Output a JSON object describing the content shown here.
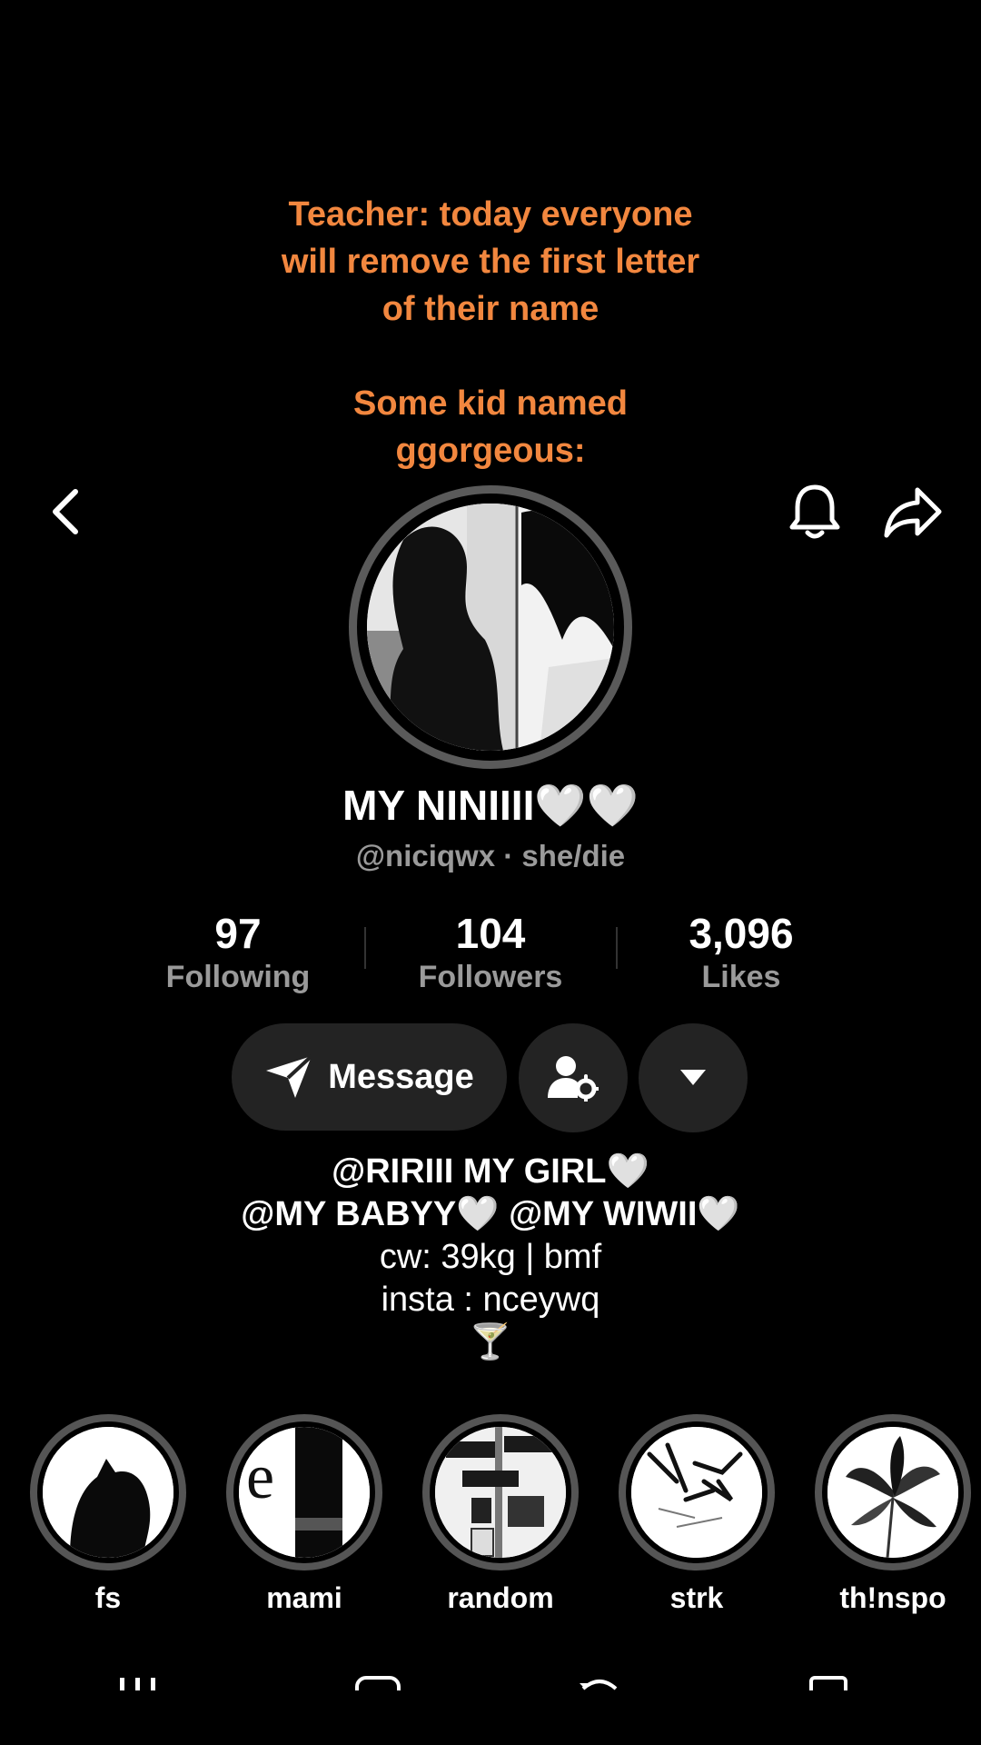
{
  "caption": {
    "line1": "Teacher: today everyone",
    "line2": "will remove the first letter",
    "line3": "of their name",
    "line4": "Some kid named",
    "line5": "ggorgeous:"
  },
  "profile": {
    "display_name": "MY NINIIII🤍🤍",
    "handle": "@niciqwx",
    "pronouns": "she/die"
  },
  "stats": [
    {
      "value": "97",
      "label": "Following"
    },
    {
      "value": "104",
      "label": "Followers"
    },
    {
      "value": "3,096",
      "label": "Likes"
    }
  ],
  "actions": {
    "message_label": "Message"
  },
  "bio": {
    "line1": "@RIRIII MY GIRL🤍",
    "line2": "@MY BABYY🤍 @MY WIWII🤍",
    "line3": "cw: 39kg | bmf",
    "line4": "insta : nceywq",
    "line5": "🍸"
  },
  "highlights": [
    {
      "label": "fs"
    },
    {
      "label": "mami"
    },
    {
      "label": "random"
    },
    {
      "label": "strk"
    },
    {
      "label": "th!nspo"
    }
  ],
  "colors": {
    "caption": "#f2873f",
    "background": "#000000",
    "button_bg": "#232323",
    "muted_text": "#9a9a9a"
  },
  "icons": {
    "back": "chevron-left-icon",
    "bell": "bell-icon",
    "share": "share-arrow-icon",
    "message": "send-icon",
    "friend": "user-settings-icon",
    "more": "caret-down-icon"
  }
}
